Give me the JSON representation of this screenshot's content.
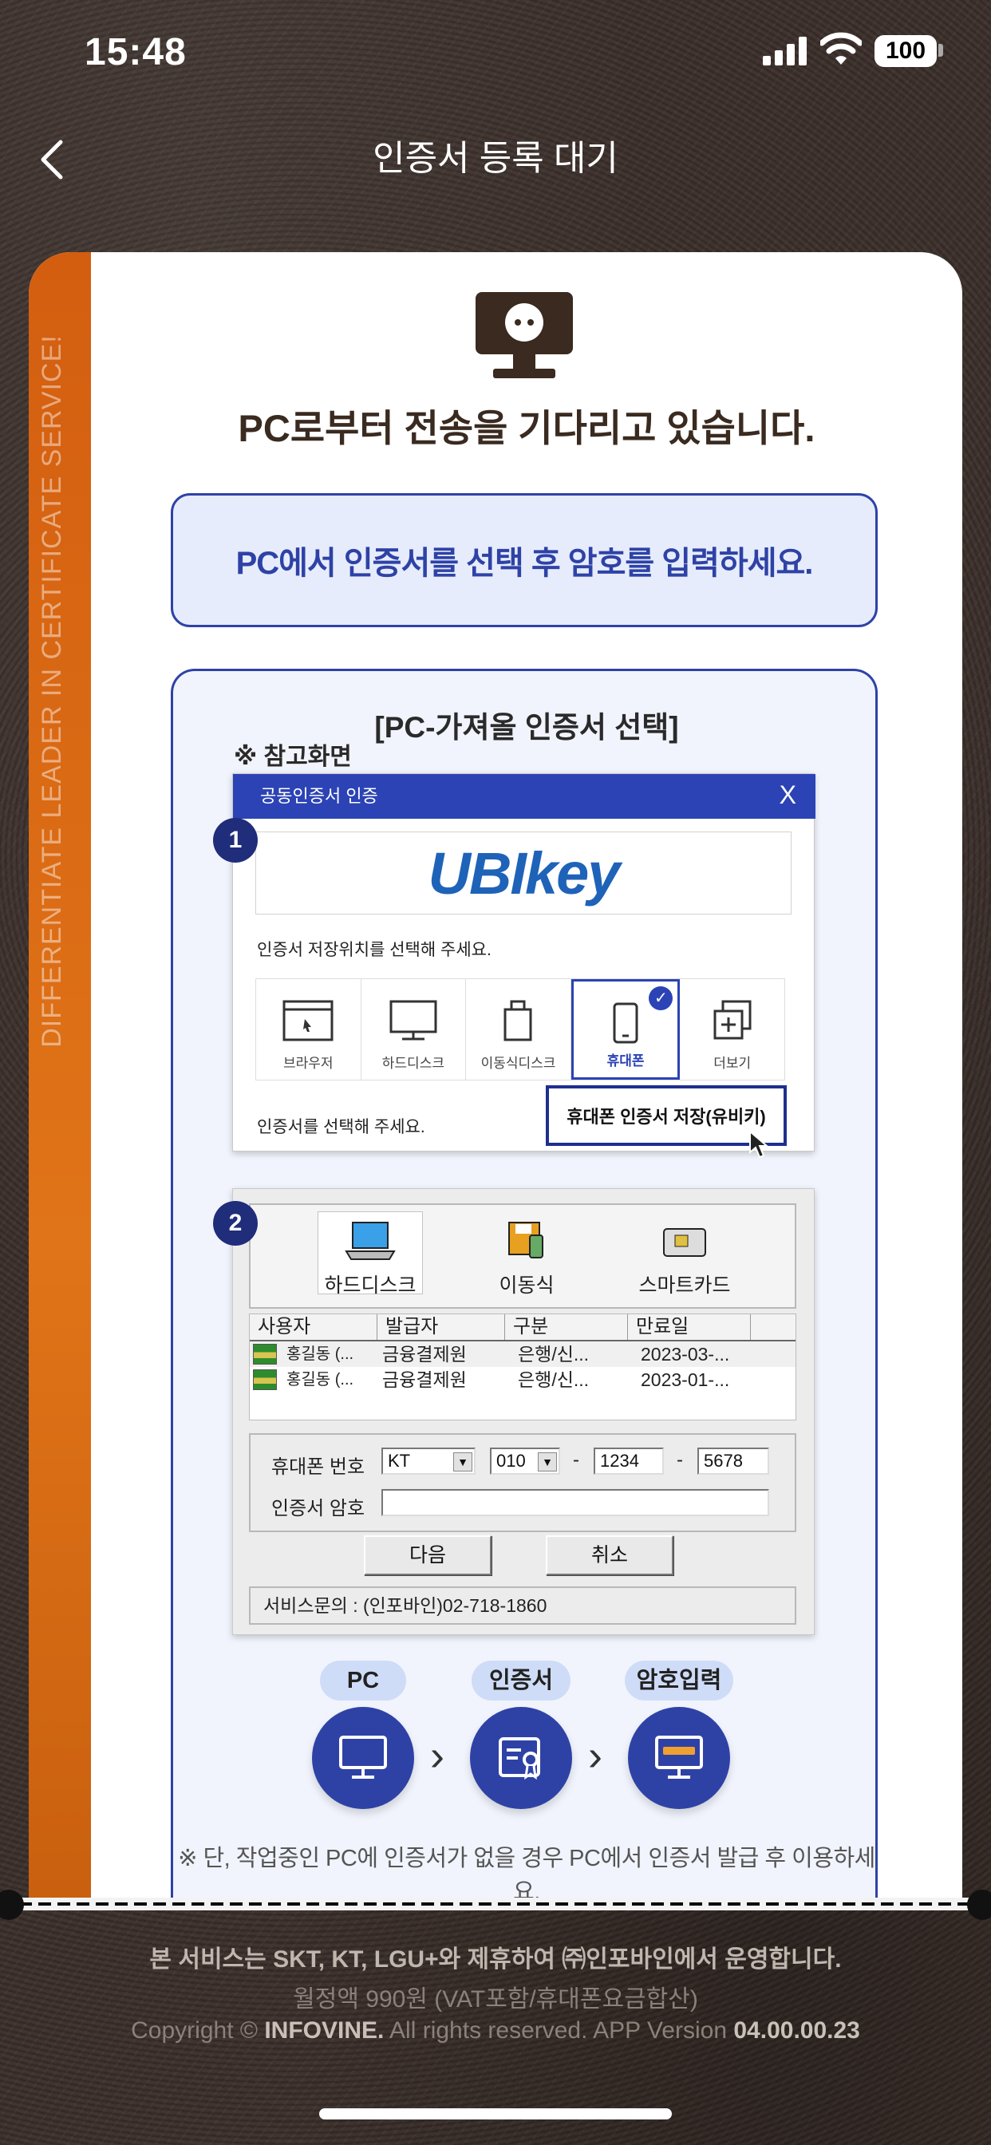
{
  "status_bar": {
    "time": "15:48",
    "battery": "100"
  },
  "nav": {
    "title": "인증서 등록 대기"
  },
  "card": {
    "stripe_text": "DIFFERENTIATE LEADER IN CERTIFICATE SERVICE!",
    "headline": "PC로부터 전송을 기다리고 있습니다.",
    "instruction": "PC에서 인증서를 선택 후 암호를 입력하세요.",
    "reference": {
      "title": "[PC-가져올 인증서 선택]",
      "note": "※ 참고화면",
      "step1": "1",
      "step2": "2",
      "window1": {
        "title": "공동인증서 인증",
        "close": "X",
        "logo": "UBIkey",
        "label_location": "인증서 저장위치를 선택해 주세요.",
        "options": [
          "브라우저",
          "하드디스크",
          "이동식디스크",
          "휴대폰",
          "더보기"
        ],
        "selected_option": "휴대폰",
        "label_select": "인증서를 선택해 주세요.",
        "tooltip": "휴대폰 인증서 저장(유비키)"
      },
      "window2": {
        "media": [
          "하드디스크",
          "이동식",
          "스마트카드"
        ],
        "columns": [
          "사용자",
          "발급자",
          "구분",
          "만료일"
        ],
        "rows": [
          {
            "user": "홍길동 (...",
            "issuer": "금융결제원",
            "type": "은행/신...",
            "expiry": "2023-03-..."
          },
          {
            "user": "홍길동 (...",
            "issuer": "금융결제원",
            "type": "은행/신...",
            "expiry": "2023-01-..."
          }
        ],
        "phone_label": "휴대폰 번호",
        "carrier": "KT",
        "prefix": "010",
        "dash": "-",
        "mid": "1234",
        "last": "5678",
        "pw_label": "인증서 암호",
        "next_button": "다음",
        "cancel_button": "취소",
        "service": "서비스문의 : (인포바인)02-718-1860"
      },
      "flow": [
        "PC",
        "인증서",
        "암호입력"
      ],
      "footnote": "※ 단, 작업중인 PC에 인증서가 없을 경우 PC에서 인증서 발급 후 이용하세요."
    }
  },
  "footer": {
    "line1": "본 서비스는 SKT, KT, LGU+와 제휴하여 ㈜인포바인에서 운영합니다.",
    "line2": "월정액 990원 (VAT포함/휴대폰요금합산)",
    "copyright_prefix": "Copyright ©",
    "company": "INFOVINE.",
    "rights": "All rights reserved. APP Version",
    "version": "04.00.00.23"
  },
  "colors": {
    "accent": "#2e42a6",
    "stripe": "#e07418",
    "window_bar": "#2b43b5"
  }
}
